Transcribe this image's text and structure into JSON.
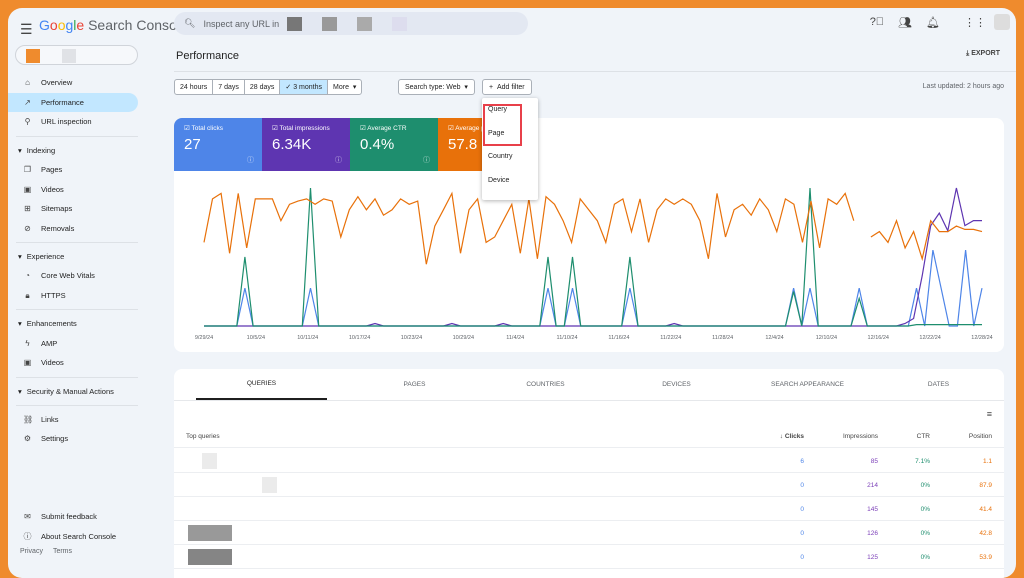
{
  "header": {
    "product": "Search Console",
    "search_placeholder": "Inspect any URL in"
  },
  "sidebar": {
    "items": [
      {
        "label": "Overview",
        "icon": "home-icon"
      },
      {
        "label": "Performance",
        "icon": "trend-icon",
        "active": true
      },
      {
        "label": "URL inspection",
        "icon": "search-icon"
      }
    ],
    "sections": [
      {
        "title": "Indexing",
        "items": [
          {
            "label": "Pages",
            "icon": "pages-icon"
          },
          {
            "label": "Videos",
            "icon": "video-icon"
          },
          {
            "label": "Sitemaps",
            "icon": "sitemap-icon"
          },
          {
            "label": "Removals",
            "icon": "removal-icon"
          }
        ]
      },
      {
        "title": "Experience",
        "items": [
          {
            "label": "Core Web Vitals",
            "icon": "gauge-icon"
          },
          {
            "label": "HTTPS",
            "icon": "lock-icon"
          }
        ]
      },
      {
        "title": "Enhancements",
        "items": [
          {
            "label": "AMP",
            "icon": "amp-icon"
          },
          {
            "label": "Videos",
            "icon": "video-icon"
          }
        ]
      },
      {
        "title": "Security & Manual Actions",
        "items": []
      }
    ],
    "bottom": [
      {
        "label": "Links",
        "icon": "links-icon"
      },
      {
        "label": "Settings",
        "icon": "gear-icon"
      }
    ],
    "help": [
      {
        "label": "Submit feedback",
        "icon": "feedback-icon"
      },
      {
        "label": "About Search Console",
        "icon": "info-icon"
      }
    ],
    "footer": [
      "Privacy",
      "Terms"
    ]
  },
  "page": {
    "title": "Performance",
    "export": "EXPORT",
    "last_updated": "Last updated: 2 hours ago"
  },
  "filters": {
    "ranges": [
      "24 hours",
      "7 days",
      "28 days",
      "3 months",
      "More"
    ],
    "selected": "3 months",
    "search_type": "Search type: Web",
    "add_filter": "Add filter",
    "menu": [
      "Query",
      "Page",
      "Country",
      "Device"
    ]
  },
  "metrics": [
    {
      "label": "Total clicks",
      "value": "27",
      "color": "#4e85e8"
    },
    {
      "label": "Total impressions",
      "value": "6.34K",
      "color": "#5e35b1"
    },
    {
      "label": "Average CTR",
      "value": "0.4%",
      "color": "#1e8e6e"
    },
    {
      "label": "Average position",
      "value": "57.8",
      "color": "#e8710a"
    }
  ],
  "chart_data": {
    "type": "line",
    "x_ticks": [
      "9/29/24",
      "10/5/24",
      "10/11/24",
      "10/17/24",
      "10/23/24",
      "10/29/24",
      "11/4/24",
      "11/10/24",
      "11/16/24",
      "11/22/24",
      "11/28/24",
      "12/4/24",
      "12/10/24",
      "12/16/24",
      "12/22/24",
      "12/28/24"
    ],
    "series": [
      {
        "metric": "Total clicks",
        "color": "#4e85e8",
        "values": [
          0,
          0,
          0,
          0,
          0,
          1,
          0,
          0,
          0,
          0,
          0,
          0,
          0,
          1,
          0,
          0,
          0,
          0,
          0,
          0,
          0,
          0,
          0,
          0,
          0,
          0,
          0,
          0,
          0,
          0,
          0,
          0,
          0,
          0,
          0,
          0,
          0,
          0,
          0,
          0,
          0,
          0,
          1,
          0,
          0,
          1,
          0,
          0,
          0,
          0,
          0,
          0,
          1,
          0,
          0,
          0,
          0,
          0,
          0,
          0,
          0,
          0,
          0,
          0,
          0,
          0,
          0,
          0,
          0,
          0,
          0,
          0,
          1,
          0,
          1,
          0,
          0,
          0,
          0,
          0,
          1,
          0,
          0,
          0,
          0,
          0,
          0,
          1,
          0,
          2,
          1,
          0,
          0,
          2,
          0,
          1
        ]
      },
      {
        "metric": "Total impressions",
        "color": "#5e35b1",
        "values": [
          0,
          0,
          0,
          0,
          0,
          0,
          0,
          0,
          0,
          0,
          0,
          0,
          0,
          0,
          0,
          0,
          0,
          0,
          0,
          0,
          1,
          0,
          0,
          0,
          0,
          0,
          0,
          0,
          0,
          1,
          0,
          0,
          0,
          0,
          0,
          1,
          0,
          0,
          0,
          0,
          0,
          0,
          0,
          0,
          0,
          0,
          0,
          0,
          0,
          0,
          0,
          0,
          0,
          0,
          0,
          1,
          0,
          0,
          0,
          0,
          0,
          0,
          0,
          0,
          0,
          0,
          0,
          0,
          0,
          0,
          0,
          0,
          0,
          0,
          0,
          0,
          0,
          0,
          0,
          0,
          0,
          0,
          1,
          3,
          20,
          40,
          45,
          38,
          55,
          40,
          42,
          42
        ]
      },
      {
        "metric": "Average CTR",
        "color": "#1e8e6e",
        "values": [
          0,
          0,
          0,
          0,
          0,
          50,
          0,
          0,
          0,
          0,
          0,
          0,
          0,
          100,
          0,
          0,
          0,
          0,
          0,
          0,
          0,
          0,
          0,
          0,
          0,
          0,
          0,
          0,
          0,
          0,
          0,
          0,
          0,
          0,
          0,
          0,
          0,
          0,
          0,
          0,
          0,
          0,
          50,
          0,
          0,
          50,
          0,
          0,
          0,
          0,
          0,
          0,
          50,
          0,
          0,
          0,
          0,
          0,
          0,
          0,
          0,
          0,
          0,
          0,
          0,
          0,
          0,
          0,
          0,
          0,
          0,
          0,
          25,
          0,
          100,
          0,
          0,
          0,
          0,
          0,
          20,
          0,
          0,
          0,
          0,
          0,
          0,
          1,
          1,
          1,
          1,
          1,
          1,
          1,
          1,
          1
        ]
      },
      {
        "metric": "Average position",
        "color": "#e8710a",
        "values": [
          40,
          80,
          85,
          30,
          85,
          35,
          80,
          80,
          80,
          60,
          75,
          78,
          80,
          75,
          80,
          78,
          45,
          70,
          82,
          70,
          80,
          65,
          70,
          80,
          75,
          78,
          20,
          55,
          70,
          85,
          30,
          70,
          80,
          40,
          45,
          60,
          75,
          30,
          80,
          25,
          82,
          75,
          60,
          40,
          80,
          70,
          60,
          40,
          75,
          80,
          50,
          80,
          40,
          70,
          80,
          75,
          80,
          75,
          60,
          25,
          85,
          45,
          70,
          75,
          65,
          80,
          70,
          50,
          80,
          75,
          40,
          78,
          35,
          80,
          75,
          85,
          60,
          null,
          45,
          50,
          40,
          60,
          35,
          50,
          25,
          60,
          50,
          50,
          55,
          52,
          52,
          50
        ]
      }
    ]
  },
  "table": {
    "tabs": [
      "QUERIES",
      "PAGES",
      "COUNTRIES",
      "DEVICES",
      "SEARCH APPEARANCE",
      "DATES"
    ],
    "active_tab": "QUERIES",
    "sort_icon": "filter-icon",
    "columns": [
      "Top queries",
      "Clicks",
      "Impressions",
      "CTR",
      "Position"
    ],
    "rows": [
      [
        "6",
        "85",
        "7.1%",
        "1.1"
      ],
      [
        "0",
        "214",
        "0%",
        "87.9"
      ],
      [
        "0",
        "145",
        "0%",
        "41.4"
      ],
      [
        "0",
        "126",
        "0%",
        "42.8"
      ],
      [
        "0",
        "125",
        "0%",
        "53.9"
      ]
    ]
  }
}
